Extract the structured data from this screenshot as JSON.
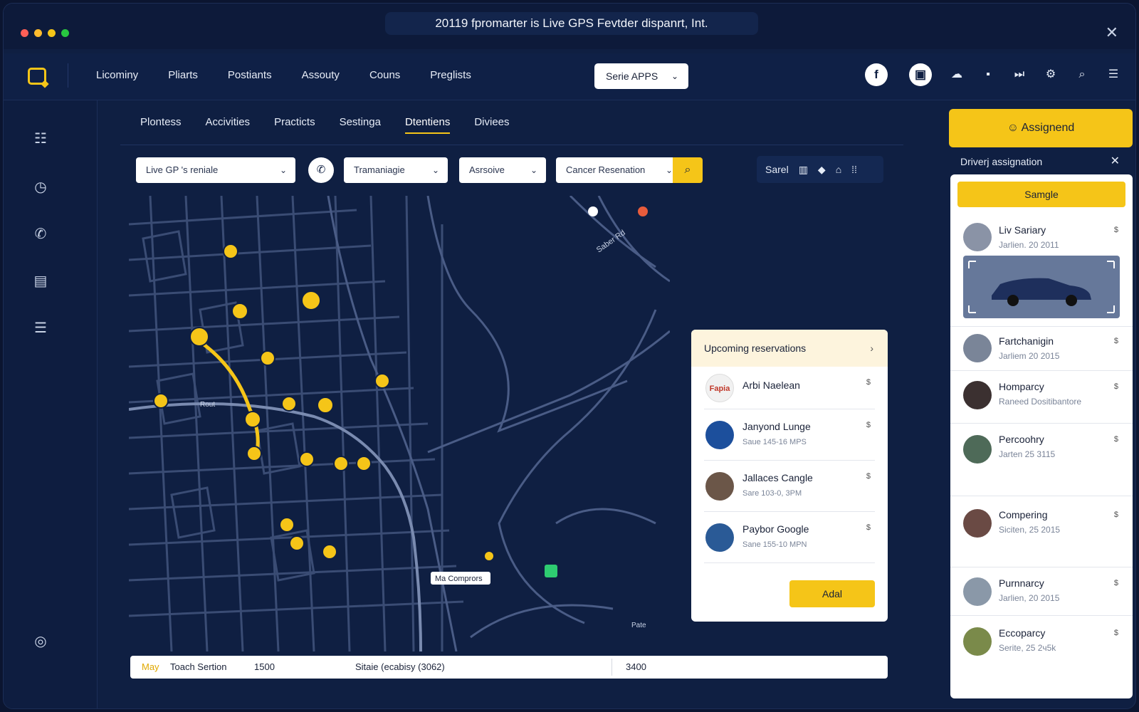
{
  "window": {
    "title": "20119 fpromarter is Live GPS Fevtder dispanrt, Int."
  },
  "colors": {
    "accent": "#f5c518",
    "background": "#0f1f42",
    "map_road": "#3a4c74",
    "route": "#f5c518"
  },
  "topnav": {
    "items": [
      "Licominy",
      "Pliarts",
      "Postiants",
      "Assouty",
      "Couns",
      "Preglists"
    ],
    "apps_select": "Serie APPS",
    "icons": [
      "facebook-icon",
      "briefcase-icon",
      "cloud-icon",
      "clipboard-icon",
      "skip-icon",
      "gear-icon",
      "search-icon",
      "notes-icon"
    ]
  },
  "sidebar": {
    "icons": [
      "list-icon",
      "clock-icon",
      "phone-icon",
      "badge-icon",
      "document-icon",
      "camera-icon"
    ]
  },
  "subtabs": {
    "items": [
      "Plontess",
      "Accivities",
      "Practicts",
      "Sestinga",
      "Dtentiens",
      "Diviees"
    ],
    "active_index": 4
  },
  "filters": {
    "location": "Live GP 's reniale",
    "type": "Tramaniagie",
    "status": "Asrsoive",
    "reservation": "Cancer Resenation"
  },
  "view_tools": {
    "label": "Sarel"
  },
  "map": {
    "labels": {
      "poi": "Ma Comprors",
      "corner": "Pate",
      "street_top": "Saber Rd",
      "street_left": "Rout"
    }
  },
  "status_bar": {
    "tag": "May",
    "section": "Toach Sertion",
    "value1": "1500",
    "middle": "Sitaie (ecabisy (3062)",
    "value2": "3400"
  },
  "upcoming": {
    "title": "Upcoming reservations",
    "items": [
      {
        "name": "Arbi Naelean",
        "sub": "",
        "logo": "Fapia"
      },
      {
        "name": "Janyond Lunge",
        "sub": "Saue 145-16 MPS"
      },
      {
        "name": "Jallaces Cangle",
        "sub": "Sare 103-0, 3PM"
      },
      {
        "name": "Paybor Google",
        "sub": "Sane 155-10 MPN"
      }
    ],
    "add_label": "Adal"
  },
  "drivers": {
    "assign_label": "Assignend",
    "header": "Driverj assignation",
    "sample_label": "Samgle",
    "items": [
      {
        "name": "Liv Sariary",
        "sub": "Jarlien. 20 2011"
      },
      {
        "name": "Fartchanigin",
        "sub": "Jarliem 20 2015"
      },
      {
        "name": "Homparcy",
        "sub": "Raneed Dositibantore"
      },
      {
        "name": "Percoohry",
        "sub": "Jarten 25 3115"
      },
      {
        "name": "Compering",
        "sub": "Siciten, 25 2015"
      },
      {
        "name": "Purnnarcy",
        "sub": "Jarlien, 20 2015"
      },
      {
        "name": "Eccoparcy",
        "sub": "Serite, 25 2ч5k"
      }
    ]
  }
}
